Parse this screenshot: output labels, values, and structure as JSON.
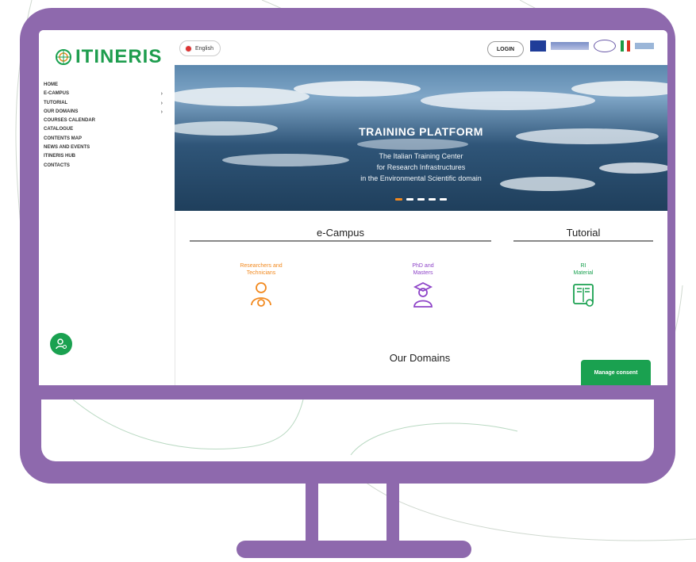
{
  "sidebar": {
    "logo_text": "ITINERIS",
    "nav": [
      {
        "label": "HOME",
        "arrow": ""
      },
      {
        "label": "E-CAMPUS",
        "arrow": "›"
      },
      {
        "label": "TUTORIAL",
        "arrow": "›"
      },
      {
        "label": "OUR DOMAINS",
        "arrow": "›"
      },
      {
        "label": "COURSES CALENDAR",
        "arrow": ""
      },
      {
        "label": "CATALOGUE",
        "arrow": ""
      },
      {
        "label": "CONTENTS MAP",
        "arrow": ""
      },
      {
        "label": "NEWS AND EVENTS",
        "arrow": ""
      },
      {
        "label": "ITINERIS HUB",
        "arrow": ""
      },
      {
        "label": "CONTACTS",
        "arrow": ""
      }
    ]
  },
  "header": {
    "language": "English",
    "login": "LOGIN"
  },
  "hero": {
    "title": "TRAINING PLATFORM",
    "line1": "The Italian Training Center",
    "line2": "for Research Infrastructures",
    "line3": "in the Environmental Scientific domain"
  },
  "sections": {
    "ecampus": "e-Campus",
    "tutorial": "Tutorial",
    "our_domains": "Our Domains"
  },
  "cards": [
    {
      "line1": "Researchers and",
      "line2": "Technicians",
      "color": "#f2891e",
      "icon": "researcher-icon"
    },
    {
      "line1": "PhD and",
      "line2": "Masters",
      "color": "#8e44c8",
      "icon": "graduate-icon"
    },
    {
      "line1": "RI",
      "line2": "Material",
      "color": "#1aa150",
      "icon": "book-icon"
    }
  ],
  "consent": {
    "label": "Manage consent"
  },
  "colors": {
    "frame": "#8e69ad",
    "brand_green": "#1aa150"
  }
}
